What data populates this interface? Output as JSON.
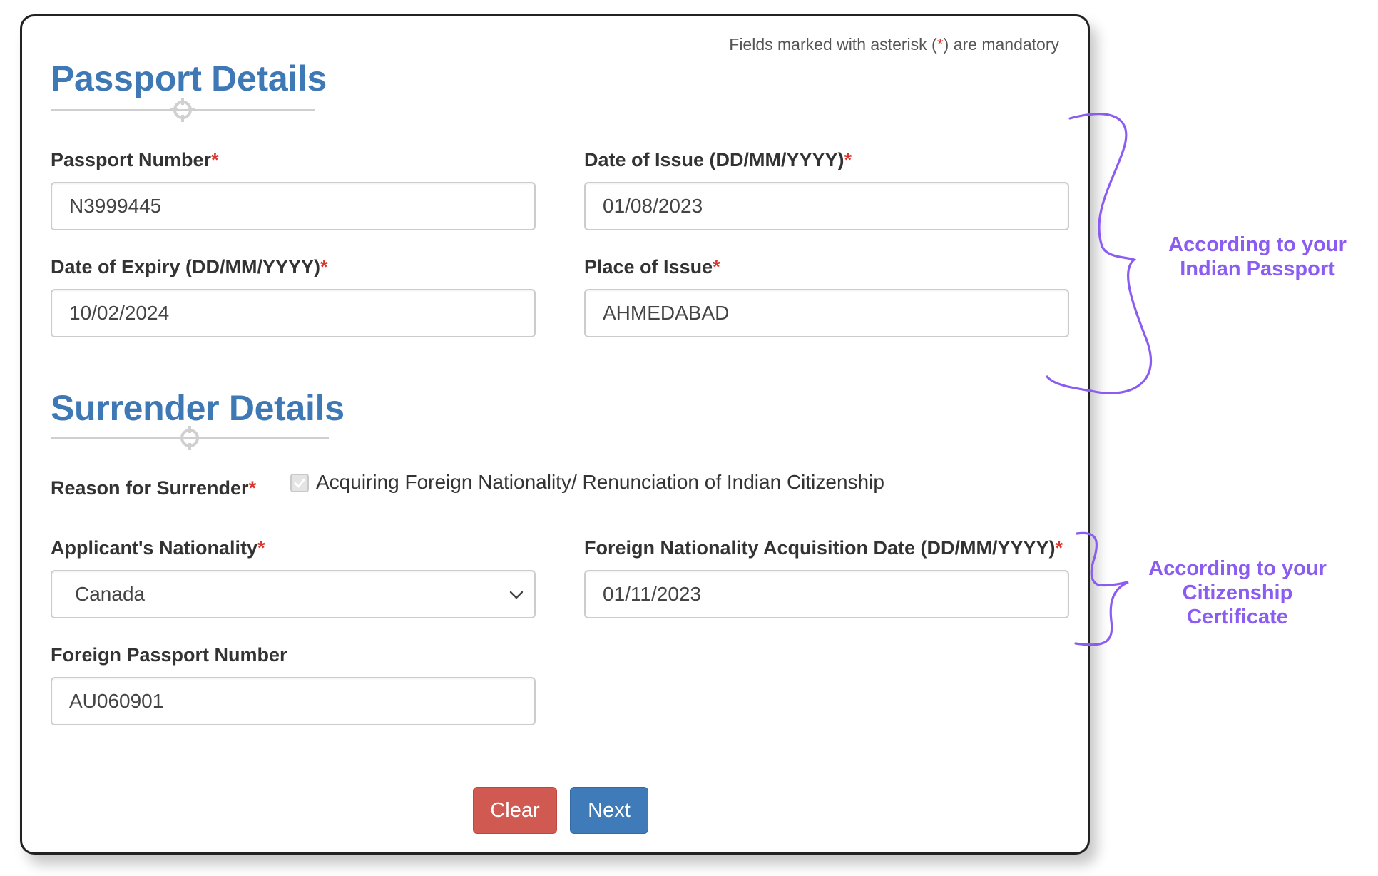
{
  "note": {
    "prefix": "Fields marked with asterisk (",
    "asterisk": "*",
    "suffix": ") are mandatory"
  },
  "passport_section": {
    "title": "Passport Details",
    "passport_number": {
      "label": "Passport Number",
      "value": "N3999445"
    },
    "date_of_issue": {
      "label": "Date of Issue (DD/MM/YYYY)",
      "value": "01/08/2023"
    },
    "date_of_expiry": {
      "label": "Date of Expiry (DD/MM/YYYY)",
      "value": "10/02/2024"
    },
    "place_of_issue": {
      "label": "Place of Issue",
      "value": "AHMEDABAD"
    }
  },
  "surrender_section": {
    "title": "Surrender Details",
    "reason": {
      "label": "Reason for Surrender",
      "option": "Acquiring Foreign Nationality/ Renunciation of Indian Citizenship",
      "checked": true
    },
    "nationality": {
      "label": "Applicant's Nationality",
      "value": "Canada"
    },
    "acquisition_date": {
      "label": "Foreign Nationality Acquisition Date (DD/MM/YYYY)",
      "value": "01/11/2023"
    },
    "foreign_passport": {
      "label": "Foreign Passport Number",
      "value": "AU060901"
    }
  },
  "buttons": {
    "clear": "Clear",
    "next": "Next"
  },
  "annotations": {
    "passport_note_line1": "According to your",
    "passport_note_line2": "Indian Passport",
    "citizenship_note_line1": "According to your",
    "citizenship_note_line2": "Citizenship",
    "citizenship_note_line3": "Certificate"
  },
  "colors": {
    "heading": "#3e79b5",
    "required": "#d9342b",
    "clear_button": "#d05a52",
    "next_button": "#3f7bb8",
    "annotation": "#8a5cf2"
  }
}
